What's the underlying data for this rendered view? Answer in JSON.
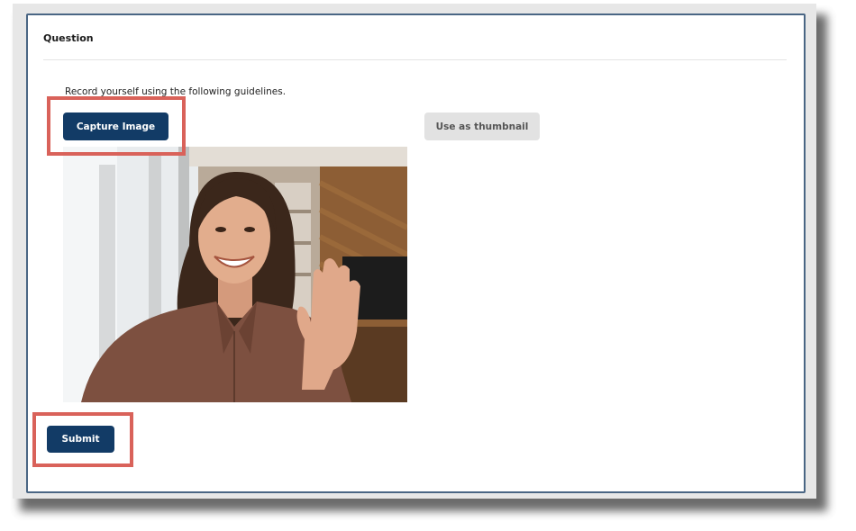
{
  "question": {
    "label": "Question",
    "instructions": "Record yourself using the following guidelines."
  },
  "actions": {
    "capture_label": "Capture Image",
    "thumbnail_label": "Use as thumbnail",
    "submit_label": "Submit"
  },
  "colors": {
    "primary_button": "#123b66",
    "disabled_button": "#e2e2e2",
    "highlight_box": "#d9625a",
    "card_border": "#4a6684"
  }
}
